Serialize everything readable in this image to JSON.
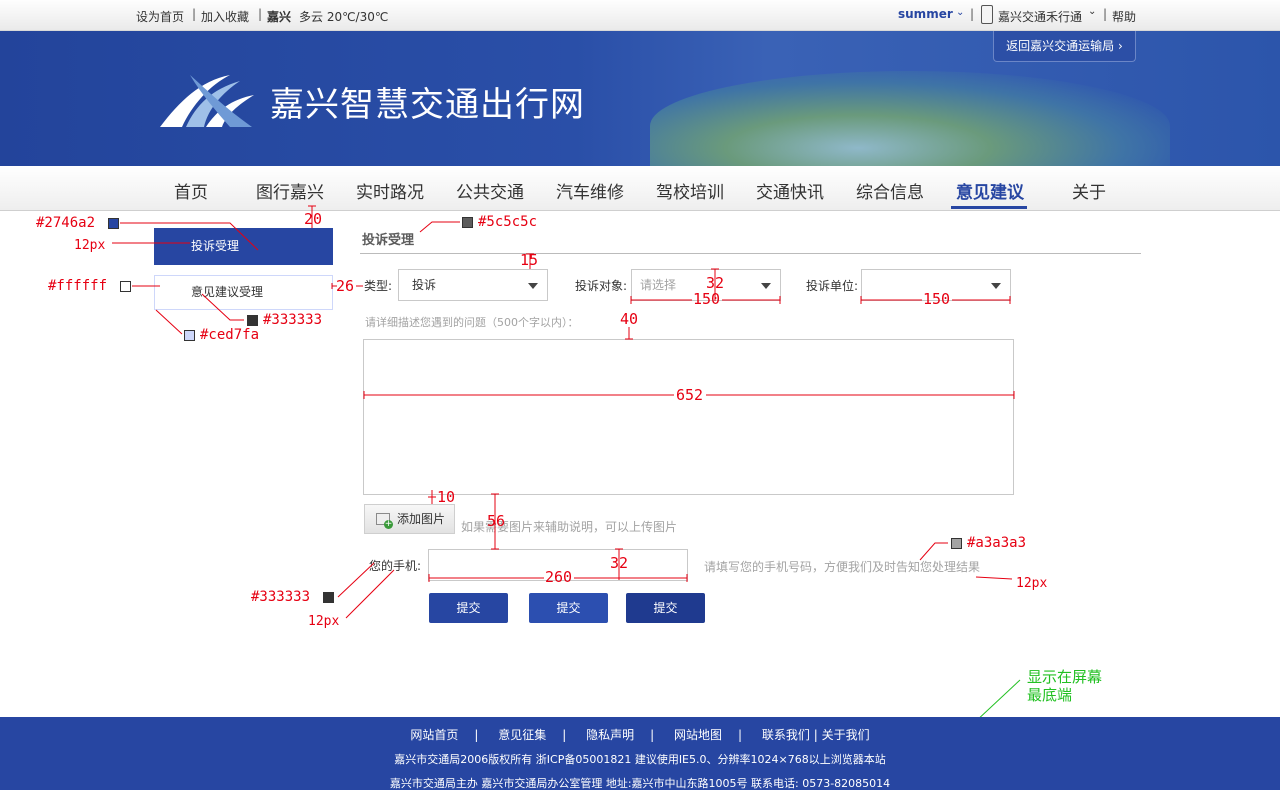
{
  "topbar": {
    "set_home": "设为首页",
    "add_fav": "加入收藏",
    "city": "嘉兴",
    "weather": "多云 20℃/30℃",
    "user": "summer",
    "app": "嘉兴交通禾行通",
    "help": "帮助"
  },
  "banner": {
    "title": "嘉兴智慧交通出行网",
    "back_button": "返回嘉兴交通运输局"
  },
  "nav": {
    "items": [
      "首页",
      "图行嘉兴",
      "实时路况",
      "公共交通",
      "汽车维修",
      "驾校培训",
      "交通快讯",
      "综合信息",
      "意见建议",
      "关于"
    ],
    "active": "意见建议"
  },
  "sidebar": {
    "items": [
      "投诉受理",
      "意见建议受理"
    ]
  },
  "form": {
    "section_title": "投诉受理",
    "type_label": "类型:",
    "type_value": "投诉",
    "target_label": "投诉对象:",
    "target_placeholder": "请选择",
    "unit_label": "投诉单位:",
    "unit_value": "",
    "describe_hint": "请详细描述您遇到的问题（500个字以内）：",
    "add_image_label": "添加图片",
    "add_image_hint": "如果需要图片来辅助说明，可以上传图片",
    "phone_label": "您的手机:",
    "phone_hint": "请填写您的手机号码，方便我们及时告知您处理结果",
    "submit_buttons": [
      "提交",
      "提交",
      "提交"
    ]
  },
  "submit_colors": [
    "#2746a2",
    "#2c4fb0",
    "#1f3a8f"
  ],
  "annotations": {
    "color_2746a2": "#2746a2",
    "size_12px_a": "12px",
    "num_20": "20",
    "color_5c5c5c": "#5c5c5c",
    "num_15": "15",
    "color_ffffff": "#ffffff",
    "num_26": "26",
    "num_32a": "32",
    "num_150a": "150",
    "num_150b": "150",
    "color_333333_a": "#333333",
    "color_ced7fa": "#ced7fa",
    "num_40": "40",
    "num_652": "652",
    "num_10": "10",
    "num_56": "56",
    "color_a3a3a3": "#a3a3a3",
    "num_32b": "32",
    "num_260": "260",
    "size_12px_b": "12px",
    "color_333333_b": "#333333",
    "size_12px_c": "12px",
    "bottom_note": "显示在屏幕\n最底端"
  },
  "footer": {
    "links": [
      "网站首页",
      "意见征集",
      "隐私声明",
      "网站地图",
      "联系我们"
    ],
    "about": "关于我们",
    "copyright": "嘉兴市交通局2006版权所有 浙ICP备05001821 建议使用IE5.0、分辨率1024×768以上浏览器本站",
    "contact": "嘉兴市交通局主办 嘉兴市交通局办公室管理  地址:嘉兴市中山东路1005号 联系电话: 0573-82085014"
  }
}
